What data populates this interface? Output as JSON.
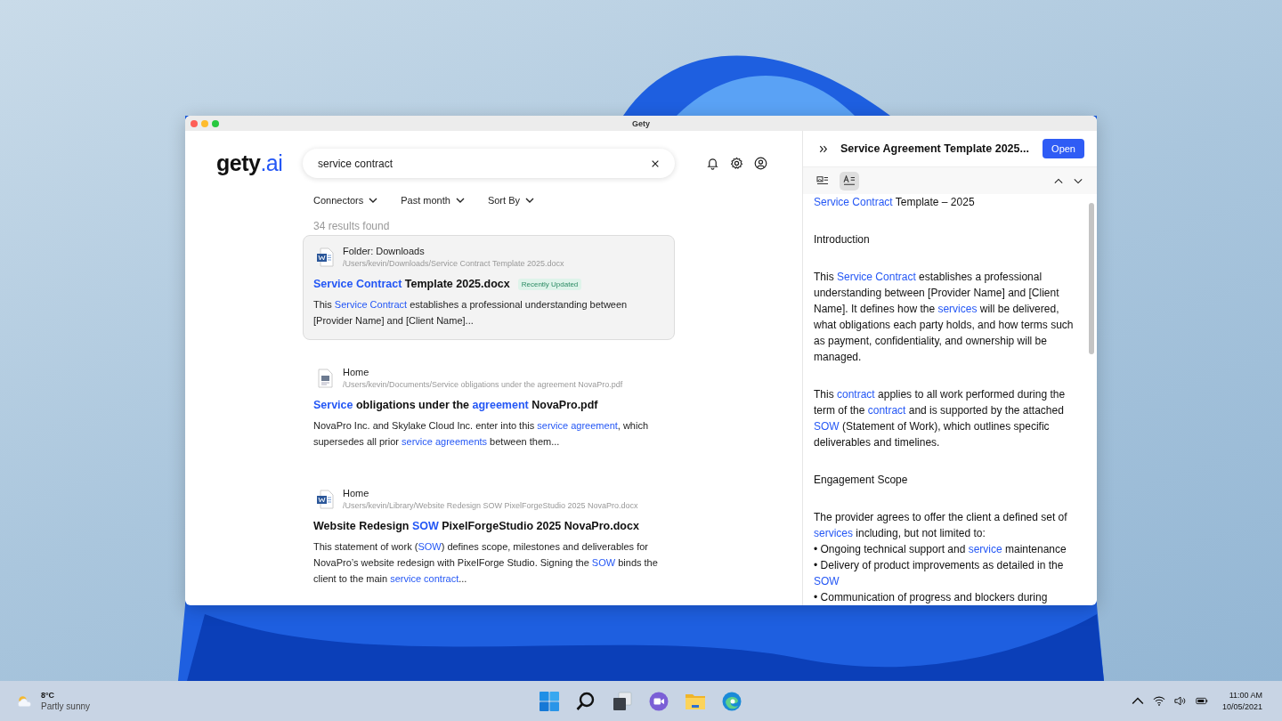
{
  "window": {
    "title": "Gety"
  },
  "logo": {
    "main": "gety",
    "accent": ".ai"
  },
  "search": {
    "value": "service contract"
  },
  "filters": [
    {
      "label": "Connectors"
    },
    {
      "label": "Past month"
    },
    {
      "label": "Sort By"
    }
  ],
  "results_count": "34 results found",
  "results": [
    {
      "selected": true,
      "kind": "docx",
      "folder": "Folder: Downloads",
      "path": "/Users/kevin/Downloads/Service Contract Template 2025.docx",
      "badge": "Recently Updated",
      "title": [
        {
          "text": "Service Contract",
          "match": true
        },
        {
          "text": " Template 2025.docx",
          "match": false
        }
      ],
      "snippet": [
        {
          "text": "This ",
          "match": false
        },
        {
          "text": "Service Contract",
          "match": true
        },
        {
          "text": " establishes a professional understanding between [Provider Name] and [Client Name]...",
          "match": false
        }
      ]
    },
    {
      "selected": false,
      "kind": "pdf",
      "folder": "Home",
      "path": "/Users/kevin/Documents/Service obligations under the agreement NovaPro.pdf",
      "title": [
        {
          "text": "Service",
          "match": true
        },
        {
          "text": " obligations under the ",
          "match": false
        },
        {
          "text": "agreement",
          "match": true
        },
        {
          "text": " NovaPro.pdf",
          "match": false
        }
      ],
      "snippet": [
        {
          "text": "NovaPro Inc. and Skylake Cloud Inc. enter into this ",
          "match": false
        },
        {
          "text": "service agreement",
          "match": true
        },
        {
          "text": ", which supersedes all prior ",
          "match": false
        },
        {
          "text": "service agreements",
          "match": true
        },
        {
          "text": " between them...",
          "match": false
        }
      ]
    },
    {
      "selected": false,
      "kind": "docx",
      "folder": "Home",
      "path": "/Users/kevin/Library/Website Redesign SOW PixelForgeStudio 2025 NovaPro.docx",
      "title": [
        {
          "text": "Website Redesign ",
          "match": false
        },
        {
          "text": "SOW",
          "match": true
        },
        {
          "text": " PixelForgeStudio 2025 NovaPro.docx",
          "match": false
        }
      ],
      "snippet": [
        {
          "text": "This statement of work (",
          "match": false
        },
        {
          "text": "SOW",
          "match": true
        },
        {
          "text": ") defines scope, milestones and deliverables for NovaPro’s website redesign with PixelForge Studio. Signing the ",
          "match": false
        },
        {
          "text": "SOW",
          "match": true
        },
        {
          "text": " binds the client to the main ",
          "match": false
        },
        {
          "text": "service contract",
          "match": true
        },
        {
          "text": "...",
          "match": false
        }
      ]
    }
  ],
  "preview": {
    "title": "Service Agreement Template 2025...",
    "open_button": "Open",
    "view_modes": [
      {
        "kind": "image-text",
        "selected": false
      },
      {
        "kind": "text",
        "selected": true
      }
    ],
    "blocks": [
      {
        "kind": "paragraph",
        "segments": [
          {
            "text": "Service Contract",
            "match": true
          },
          {
            "text": " Template – 2025",
            "match": false
          }
        ]
      },
      {
        "kind": "paragraph",
        "segments": [
          {
            "text": "Introduction",
            "match": false
          }
        ]
      },
      {
        "kind": "paragraph",
        "segments": [
          {
            "text": "This ",
            "match": false
          },
          {
            "text": "Service Contract",
            "match": true
          },
          {
            "text": " establishes a professional understanding between [Provider Name] and [Client Name]. It defines how the ",
            "match": false
          },
          {
            "text": "services",
            "match": true
          },
          {
            "text": " will be delivered, what obligations each party holds, and how terms such as payment, confidentiality, and ownership will be managed.",
            "match": false
          }
        ]
      },
      {
        "kind": "paragraph",
        "segments": [
          {
            "text": "This ",
            "match": false
          },
          {
            "text": "contract",
            "match": true
          },
          {
            "text": " applies to all work performed during the term of the ",
            "match": false
          },
          {
            "text": "contract",
            "match": true
          },
          {
            "text": " and is supported by the attached ",
            "match": false
          },
          {
            "text": "SOW",
            "match": true
          },
          {
            "text": " (Statement of Work), which outlines specific deliverables and timelines.",
            "match": false
          }
        ]
      },
      {
        "kind": "paragraph",
        "segments": [
          {
            "text": "Engagement Scope",
            "match": false
          }
        ]
      },
      {
        "kind": "intro",
        "segments": [
          {
            "text": "The provider agrees to offer the client a defined set of ",
            "match": false
          },
          {
            "text": "services",
            "match": true
          },
          {
            "text": " including, but not limited to:",
            "match": false
          }
        ]
      },
      {
        "kind": "bullet",
        "segments": [
          {
            "text": " • Ongoing technical support and ",
            "match": false
          },
          {
            "text": "service",
            "match": true
          },
          {
            "text": " maintenance",
            "match": false
          }
        ]
      },
      {
        "kind": "bullet",
        "segments": [
          {
            "text": " • Delivery of product improvements as detailed in the ",
            "match": false
          },
          {
            "text": "SOW",
            "match": true
          }
        ]
      },
      {
        "kind": "bullet",
        "segments": [
          {
            "text": " • Communication of progress and blockers during",
            "match": false
          }
        ]
      }
    ]
  },
  "taskbar": {
    "weather": {
      "temp": "8°C",
      "condition": "Partly sunny"
    },
    "time": "11:00 AM",
    "date": "10/05/2021"
  }
}
